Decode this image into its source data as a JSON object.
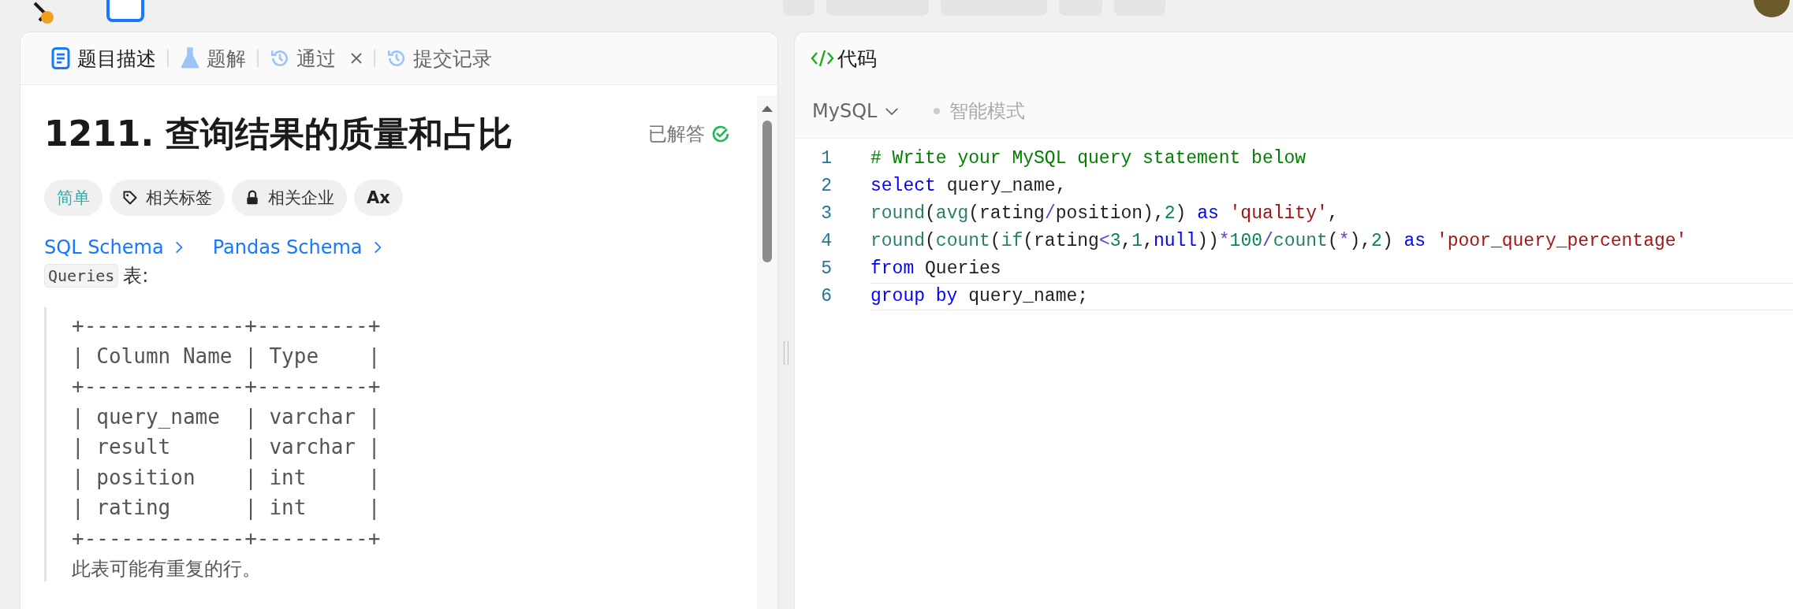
{
  "tabs": [
    {
      "label": "题目描述",
      "kind": "doc",
      "selected": true,
      "closable": false
    },
    {
      "label": "题解",
      "kind": "flask",
      "selected": false,
      "closable": false
    },
    {
      "label": "通过",
      "kind": "history",
      "selected": false,
      "closable": true
    },
    {
      "label": "提交记录",
      "kind": "history",
      "selected": false,
      "closable": false
    }
  ],
  "problem": {
    "title": "1211. 查询结果的质量和占比",
    "status": "已解答",
    "solved": true,
    "tags": [
      {
        "label": "简单",
        "kind": "difficulty"
      },
      {
        "label": "相关标签",
        "kind": "tag"
      },
      {
        "label": "相关企业",
        "kind": "lock"
      },
      {
        "label": "Ax",
        "kind": "translate"
      }
    ],
    "links": [
      "SQL Schema",
      "Pandas Schema"
    ],
    "intro": {
      "code": "Queries",
      "text": "表:"
    },
    "schema_lines": [
      "+-------------+---------+",
      "| Column Name | Type    |",
      "+-------------+---------+",
      "| query_name  | varchar |",
      "| result      | varchar |",
      "| position    | int     |",
      "| rating      | int     |",
      "+-------------+---------+"
    ],
    "note": "此表可能有重复的行。"
  },
  "editor": {
    "title": "代码",
    "language": "MySQL",
    "mode": {
      "label": "智能模式",
      "on": false
    },
    "lines": [
      {
        "number": "1",
        "active": false,
        "tokens": [
          {
            "kind": "comment",
            "text": "# Write your MySQL query statement below"
          }
        ]
      },
      {
        "number": "2",
        "active": false,
        "tokens": [
          {
            "kind": "keyword",
            "text": "select"
          },
          {
            "kind": "plain",
            "text": " query_name,"
          }
        ]
      },
      {
        "number": "3",
        "active": false,
        "tokens": [
          {
            "kind": "function",
            "text": "round"
          },
          {
            "kind": "plain",
            "text": "("
          },
          {
            "kind": "function",
            "text": "avg"
          },
          {
            "kind": "plain",
            "text": "(rating"
          },
          {
            "kind": "operator",
            "text": "/"
          },
          {
            "kind": "plain",
            "text": "position),"
          },
          {
            "kind": "number",
            "text": "2"
          },
          {
            "kind": "plain",
            "text": ") "
          },
          {
            "kind": "keyword",
            "text": "as"
          },
          {
            "kind": "string",
            "text": " 'quality'"
          },
          {
            "kind": "plain",
            "text": ","
          }
        ]
      },
      {
        "number": "4",
        "active": false,
        "tokens": [
          {
            "kind": "function",
            "text": "round"
          },
          {
            "kind": "plain",
            "text": "("
          },
          {
            "kind": "function",
            "text": "count"
          },
          {
            "kind": "plain",
            "text": "("
          },
          {
            "kind": "function",
            "text": "if"
          },
          {
            "kind": "plain",
            "text": "(rating"
          },
          {
            "kind": "operator",
            "text": "<"
          },
          {
            "kind": "number",
            "text": "3"
          },
          {
            "kind": "plain",
            "text": ","
          },
          {
            "kind": "number",
            "text": "1"
          },
          {
            "kind": "plain",
            "text": ","
          },
          {
            "kind": "keyword",
            "text": "null"
          },
          {
            "kind": "plain",
            "text": "))"
          },
          {
            "kind": "operator",
            "text": "*"
          },
          {
            "kind": "number",
            "text": "100"
          },
          {
            "kind": "operator",
            "text": "/"
          },
          {
            "kind": "function",
            "text": "count"
          },
          {
            "kind": "plain",
            "text": "("
          },
          {
            "kind": "operator",
            "text": "*"
          },
          {
            "kind": "plain",
            "text": "),"
          },
          {
            "kind": "number",
            "text": "2"
          },
          {
            "kind": "plain",
            "text": ") "
          },
          {
            "kind": "keyword",
            "text": "as"
          },
          {
            "kind": "string",
            "text": " 'poor_query_percentage'"
          }
        ]
      },
      {
        "number": "5",
        "active": false,
        "tokens": [
          {
            "kind": "keyword",
            "text": "from"
          },
          {
            "kind": "plain",
            "text": " Queries"
          }
        ]
      },
      {
        "number": "6",
        "active": true,
        "tokens": [
          {
            "kind": "keyword",
            "text": "group by"
          },
          {
            "kind": "plain",
            "text": " query_name;"
          }
        ]
      }
    ]
  }
}
